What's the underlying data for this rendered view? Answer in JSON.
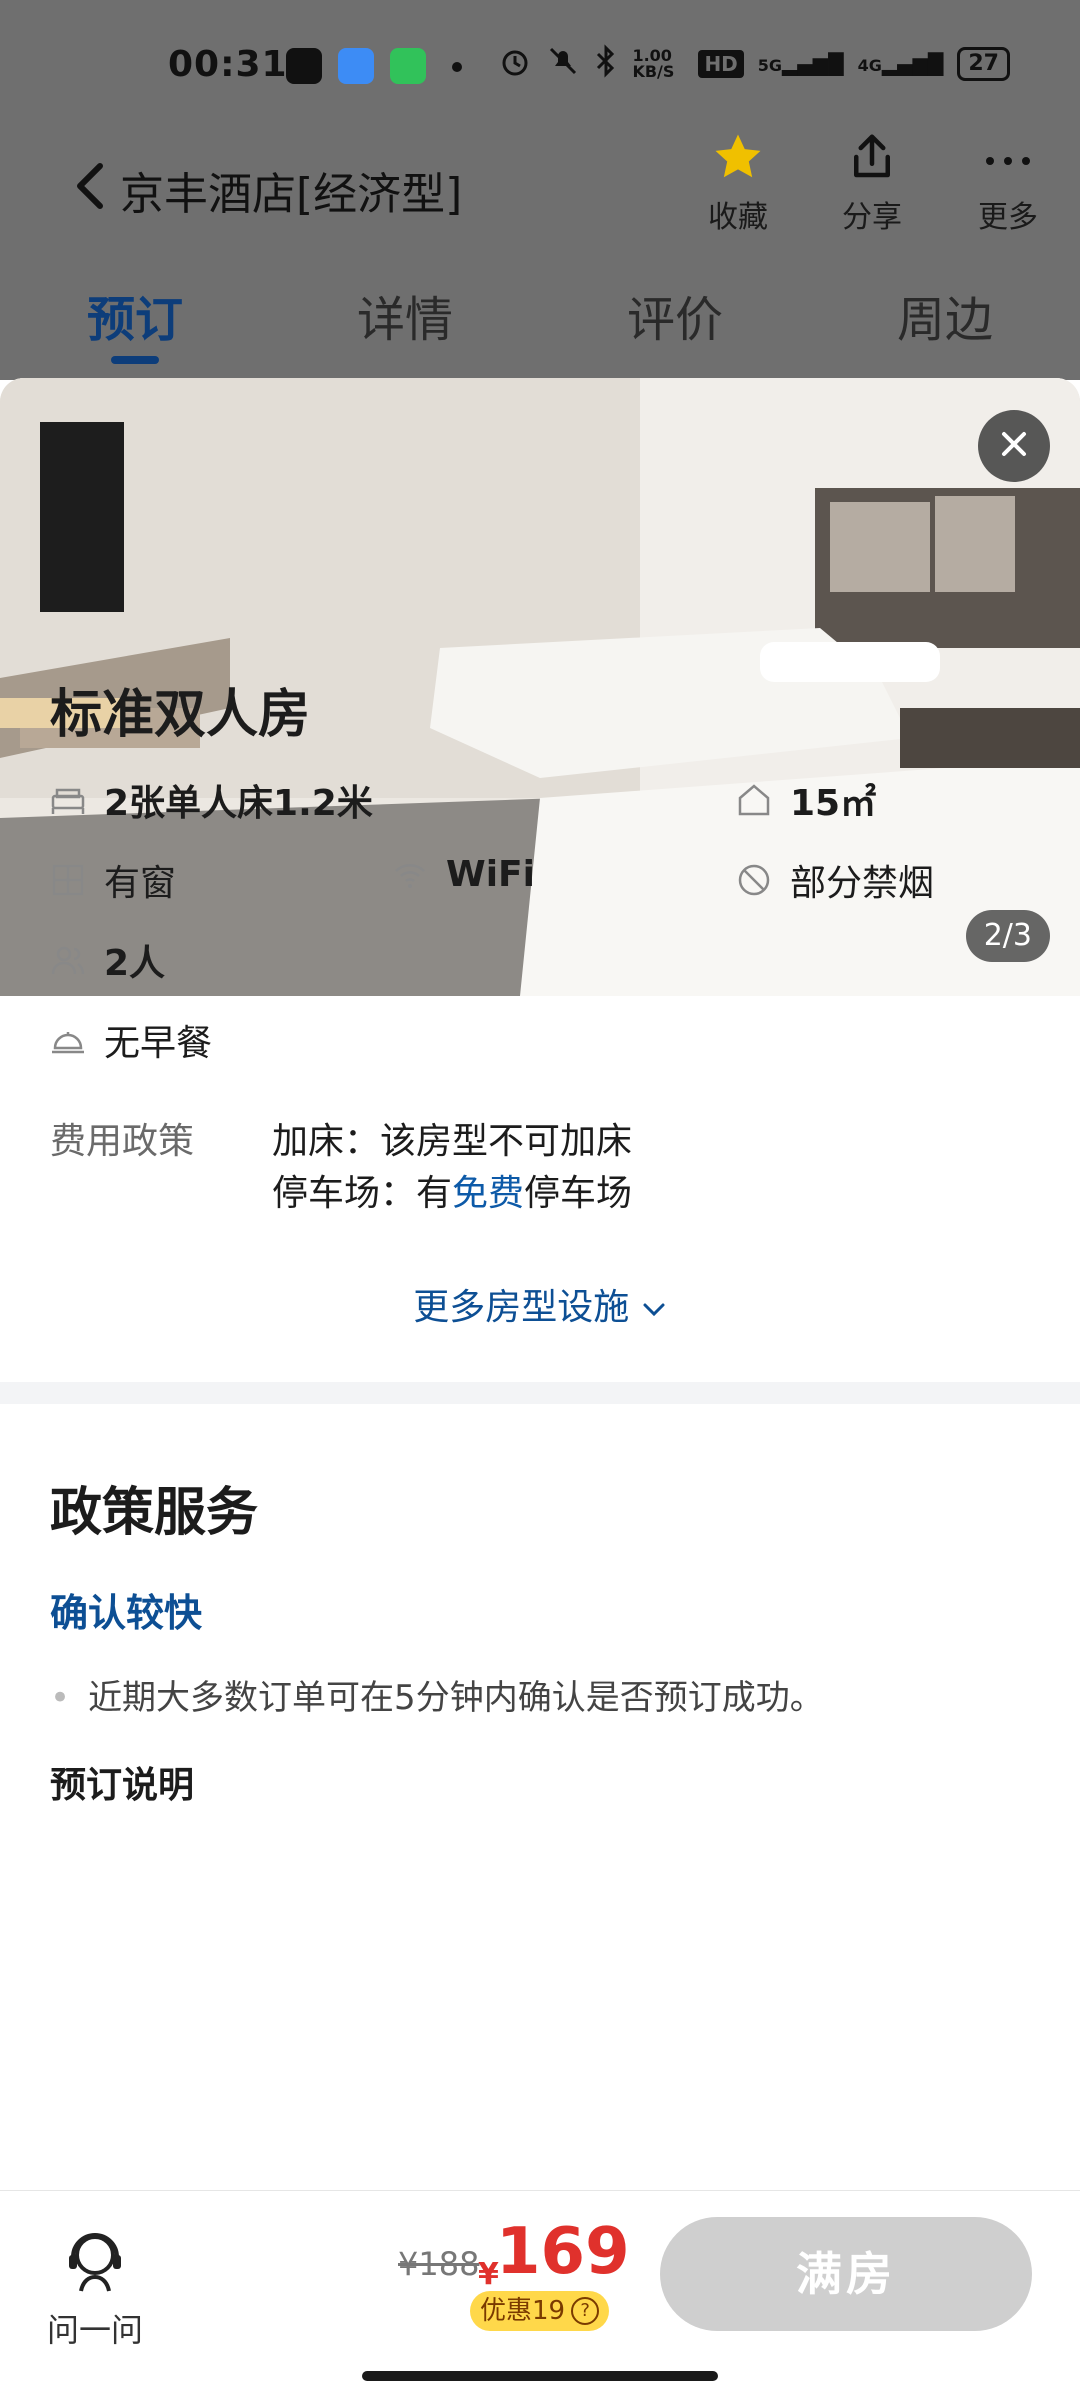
{
  "status_bar": {
    "time": "00:31",
    "network_speed": "1.00 KB/S",
    "hd": "HD",
    "sig1": "5G",
    "sig2": "4G",
    "battery": "27"
  },
  "header": {
    "title": "京丰酒店[经济型]",
    "actions": [
      {
        "label": "收藏",
        "icon": "star-icon"
      },
      {
        "label": "分享",
        "icon": "share-icon"
      },
      {
        "label": "更多",
        "icon": "more-icon"
      }
    ]
  },
  "tabs": [
    {
      "label": "预订",
      "active": true
    },
    {
      "label": "详情",
      "active": false
    },
    {
      "label": "评价",
      "active": false
    },
    {
      "label": "周边",
      "active": false
    }
  ],
  "room": {
    "pager": "2/3",
    "name": "标准双人房",
    "facilities": {
      "bed": "2张单人床1.2米",
      "area": "15㎡",
      "window": "有窗",
      "wifi": "WiFi",
      "smoking": "部分禁烟",
      "guests": "2人",
      "breakfast": "无早餐"
    },
    "policy_label": "费用政策",
    "policy_line1": "加床：该房型不可加床",
    "policy_line2_prefix": "停车场：有",
    "policy_line2_highlight": "免费",
    "policy_line2_suffix": "停车场",
    "more_link": "更多房型设施"
  },
  "policy_section": {
    "title": "政策服务",
    "confirm_heading": "确认较快",
    "confirm_text": "近期大多数订单可在5分钟内确认是否预订成功。",
    "booking_heading": "预订说明"
  },
  "bottom_bar": {
    "ask_label": "问一问",
    "old_price": "¥188",
    "currency": "¥",
    "price": "169",
    "discount": "优惠19",
    "discount_icon": "?",
    "action_label": "满房"
  },
  "colors": {
    "accent": "#0d3d7a",
    "link": "#0d4f94",
    "price": "#e0312c",
    "discount_bg": "#ffd84a",
    "disabled_button": "#cfcfcf"
  }
}
